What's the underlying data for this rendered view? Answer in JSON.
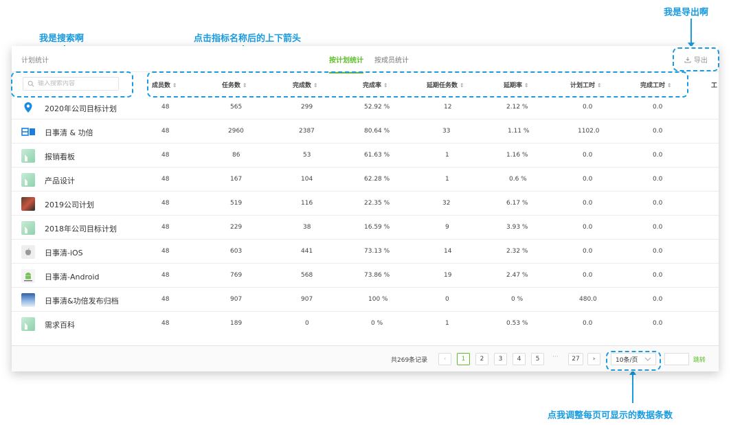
{
  "annotations": {
    "search": "我是搜索啊",
    "sort": "点击指标名称后的上下箭头",
    "export": "我是导出啊",
    "pagesize": "点我调整每页可显示的数据条数"
  },
  "header": {
    "title": "计划统计",
    "tabs": [
      {
        "label": "按计划统计",
        "active": true
      },
      {
        "label": "按成员统计",
        "active": false
      }
    ],
    "export_label": "导出"
  },
  "search": {
    "placeholder": "输入搜索内容"
  },
  "columns": [
    "成员数",
    "任务数",
    "完成数",
    "完成率",
    "延期任务数",
    "延期率",
    "计划工时",
    "完成工时",
    "工"
  ],
  "sort_icon": "⇕",
  "rows": [
    {
      "name": "2020年公司目标计划",
      "icon": "location-pin-icon",
      "values": [
        "48",
        "565",
        "299",
        "52.92 %",
        "12",
        "2.12 %",
        "0.0",
        "0.0"
      ]
    },
    {
      "name": "日事清 & 功倍",
      "icon": "rishiqing-logo-icon",
      "values": [
        "48",
        "2960",
        "2387",
        "80.64 %",
        "33",
        "1.11 %",
        "1102.0",
        "0.0"
      ]
    },
    {
      "name": "报销看板",
      "icon": "board-icon",
      "values": [
        "48",
        "86",
        "53",
        "61.63 %",
        "1",
        "1.16 %",
        "0.0",
        "0.0"
      ]
    },
    {
      "name": "产品设计",
      "icon": "board-icon",
      "values": [
        "48",
        "167",
        "104",
        "62.28 %",
        "1",
        "0.6 %",
        "0.0",
        "0.0"
      ]
    },
    {
      "name": "2019公司计划",
      "icon": "photo-icon",
      "values": [
        "48",
        "519",
        "116",
        "22.35 %",
        "32",
        "6.17 %",
        "0.0",
        "0.0"
      ]
    },
    {
      "name": "2018年公司目标计划",
      "icon": "board-icon",
      "values": [
        "48",
        "229",
        "38",
        "16.59 %",
        "9",
        "3.93 %",
        "0.0",
        "0.0"
      ]
    },
    {
      "name": "日事清-iOS",
      "icon": "apple-icon",
      "values": [
        "48",
        "603",
        "441",
        "73.13 %",
        "14",
        "2.32 %",
        "0.0",
        "0.0"
      ]
    },
    {
      "name": "日事清-Android",
      "icon": "android-icon",
      "values": [
        "48",
        "769",
        "568",
        "73.86 %",
        "19",
        "2.47 %",
        "0.0",
        "0.0"
      ]
    },
    {
      "name": "日事清&功倍发布归档",
      "icon": "landscape-icon",
      "values": [
        "48",
        "907",
        "907",
        "100 %",
        "0",
        "0 %",
        "480.0",
        "0.0"
      ]
    },
    {
      "name": "需求百科",
      "icon": "board-icon",
      "values": [
        "48",
        "189",
        "0",
        "0 %",
        "1",
        "0.53 %",
        "0.0",
        "0.0"
      ]
    }
  ],
  "pagination": {
    "total": "共269条记录",
    "prev": "‹",
    "pages": [
      "1",
      "2",
      "3",
      "4",
      "5"
    ],
    "ellipsis": "···",
    "last": "27",
    "next": "›",
    "page_size": "10条/页",
    "jump_label": "跳转"
  },
  "colors": {
    "accent": "#5cbf2a",
    "annotation": "#1a9be0"
  }
}
